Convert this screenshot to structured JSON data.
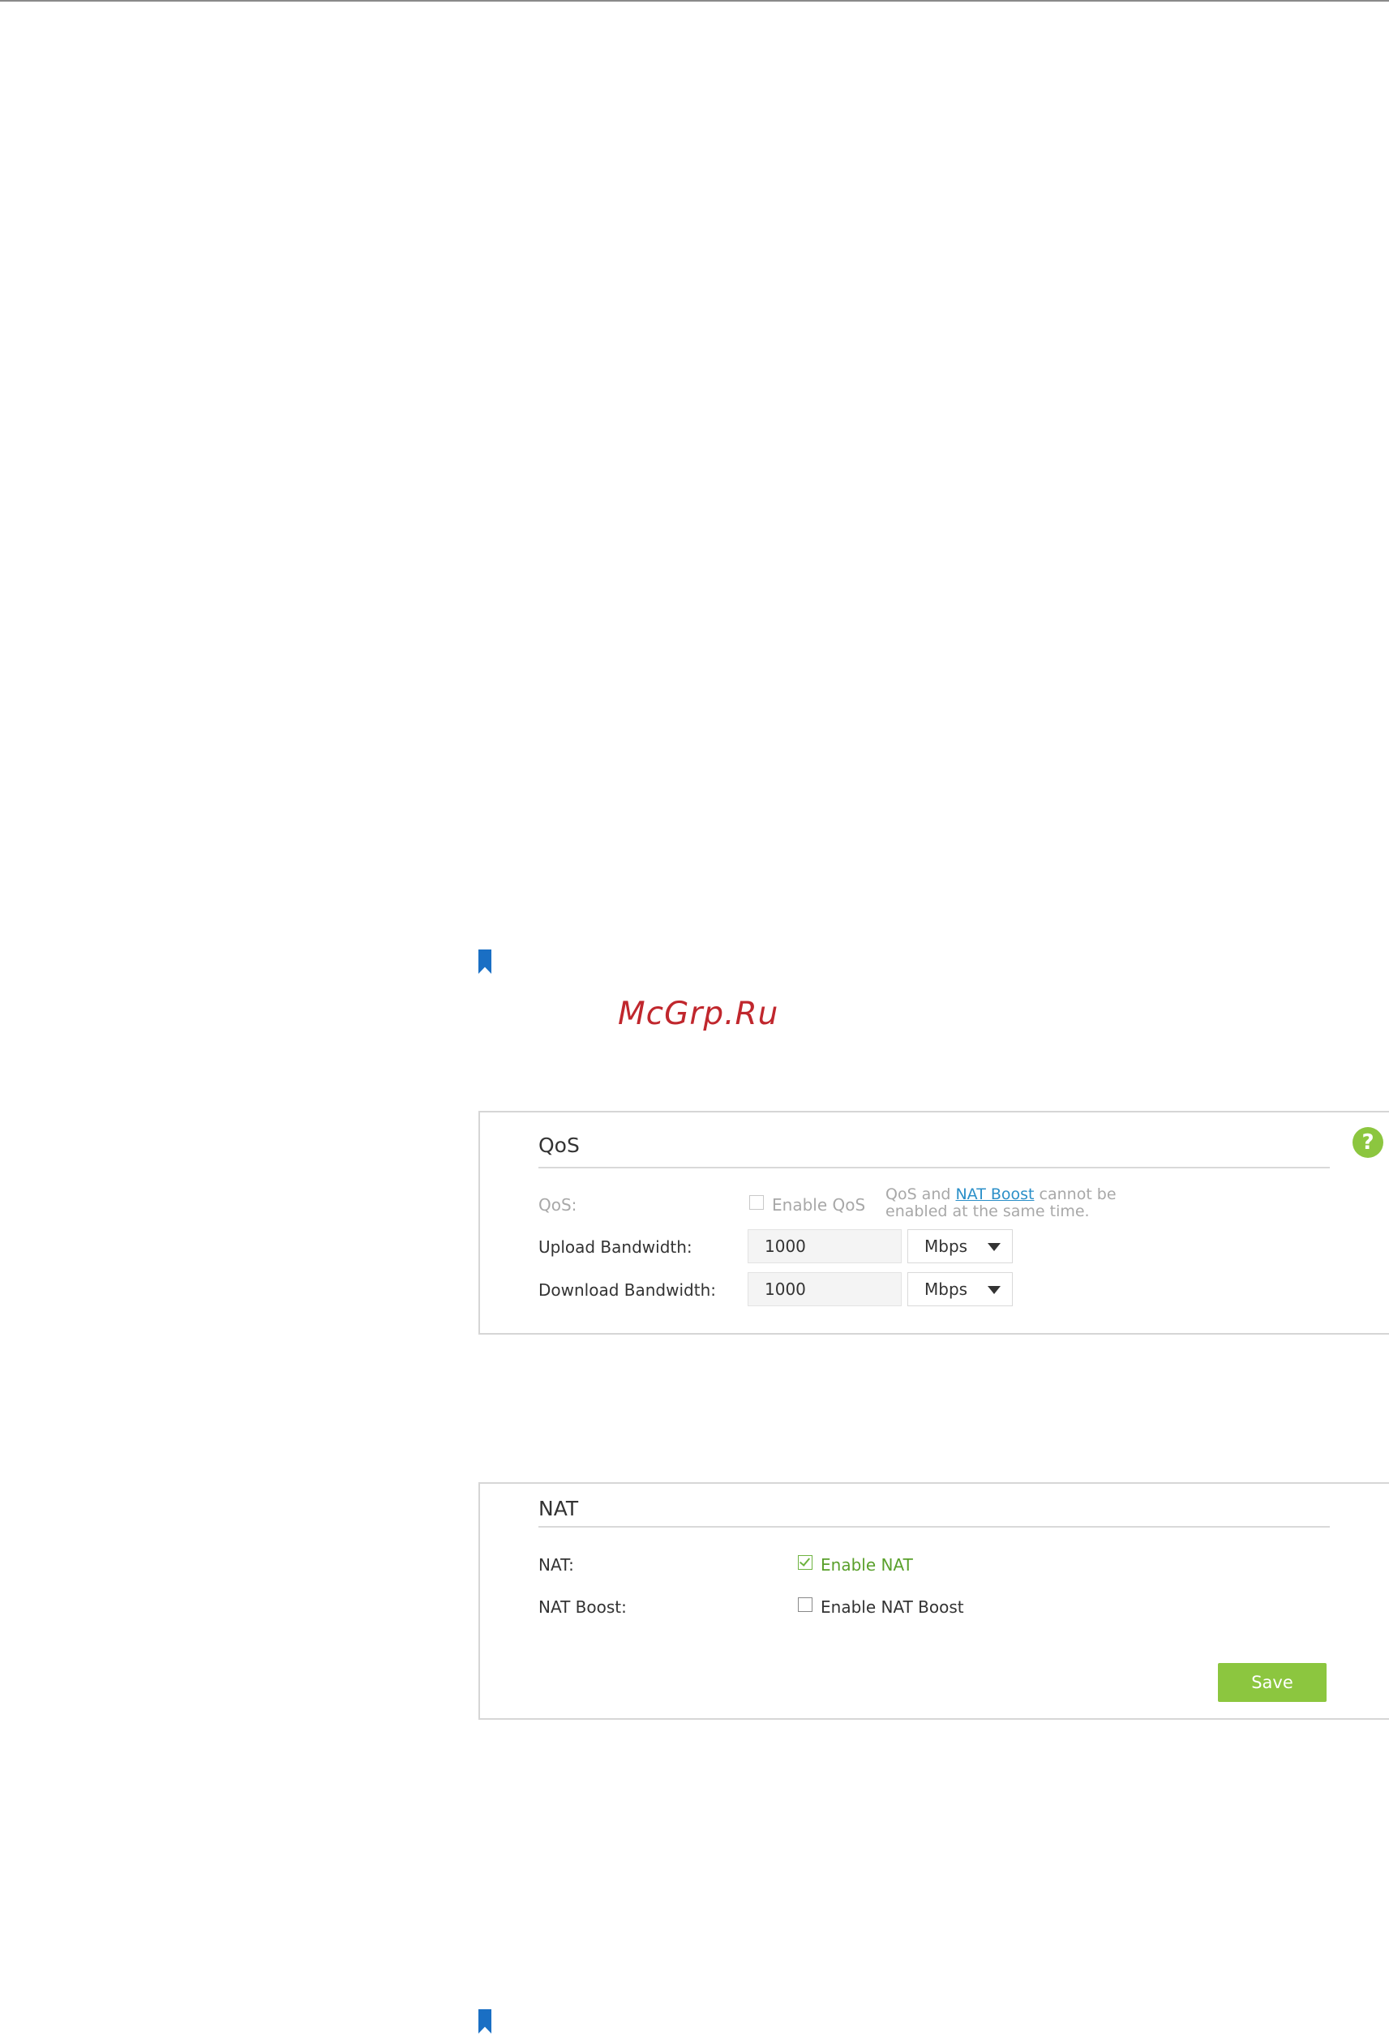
{
  "watermark": "McGrp.Ru",
  "qos_panel": {
    "title": "QoS",
    "help_icon": "?",
    "qos_label": "QoS:",
    "enable_qos_label": "Enable QoS",
    "enable_qos_checked": false,
    "note_prefix": "QoS and ",
    "note_link": "NAT Boost",
    "note_suffix": " cannot be enabled at the same time.",
    "upload_label": "Upload Bandwidth:",
    "upload_value": "1000",
    "upload_unit": "Mbps",
    "download_label": "Download Bandwidth:",
    "download_value": "1000",
    "download_unit": "Mbps"
  },
  "nat_panel": {
    "title": "NAT",
    "nat_label": "NAT:",
    "enable_nat_label": "Enable NAT",
    "enable_nat_checked": true,
    "nat_boost_label": "NAT Boost:",
    "enable_nat_boost_label": "Enable NAT Boost",
    "enable_nat_boost_checked": false,
    "save_label": "Save"
  },
  "colors": {
    "accent_green": "#8cc63f",
    "link_blue": "#2b8fc8",
    "bookmark_blue": "#1a6fc4",
    "watermark_red": "#c0272d"
  }
}
